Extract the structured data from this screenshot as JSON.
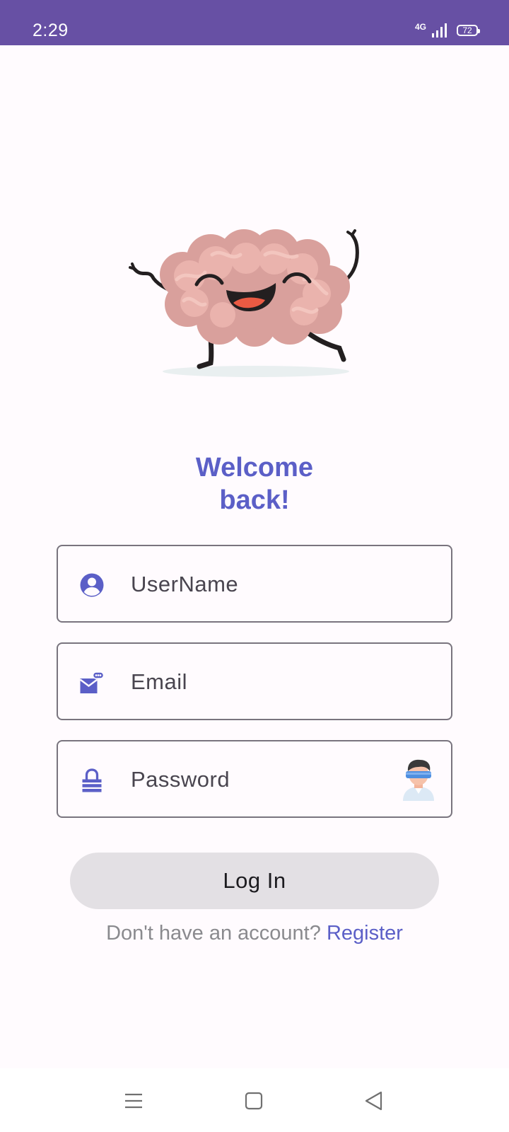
{
  "status_bar": {
    "time": "2:29",
    "network": "4G",
    "battery": "72"
  },
  "welcome": {
    "line1": "Welcome",
    "line2": "back!"
  },
  "form": {
    "username_placeholder": "UserName",
    "email_placeholder": "Email",
    "password_placeholder": "Password",
    "login_label": "Log In"
  },
  "register": {
    "prompt": "Don't have an account?",
    "link": "Register"
  },
  "icons": {
    "username": "account-circle-icon",
    "email": "mail-icon",
    "password": "lock-icon",
    "password_toggle": "hidden-eyes-avatar-icon",
    "nav_menu": "menu-icon",
    "nav_home": "square-home-icon",
    "nav_back": "back-triangle-icon"
  },
  "colors": {
    "status_bar": "#6750a4",
    "accent": "#5b5fc7",
    "background": "#fffbfe",
    "button": "#e3e0e4"
  }
}
